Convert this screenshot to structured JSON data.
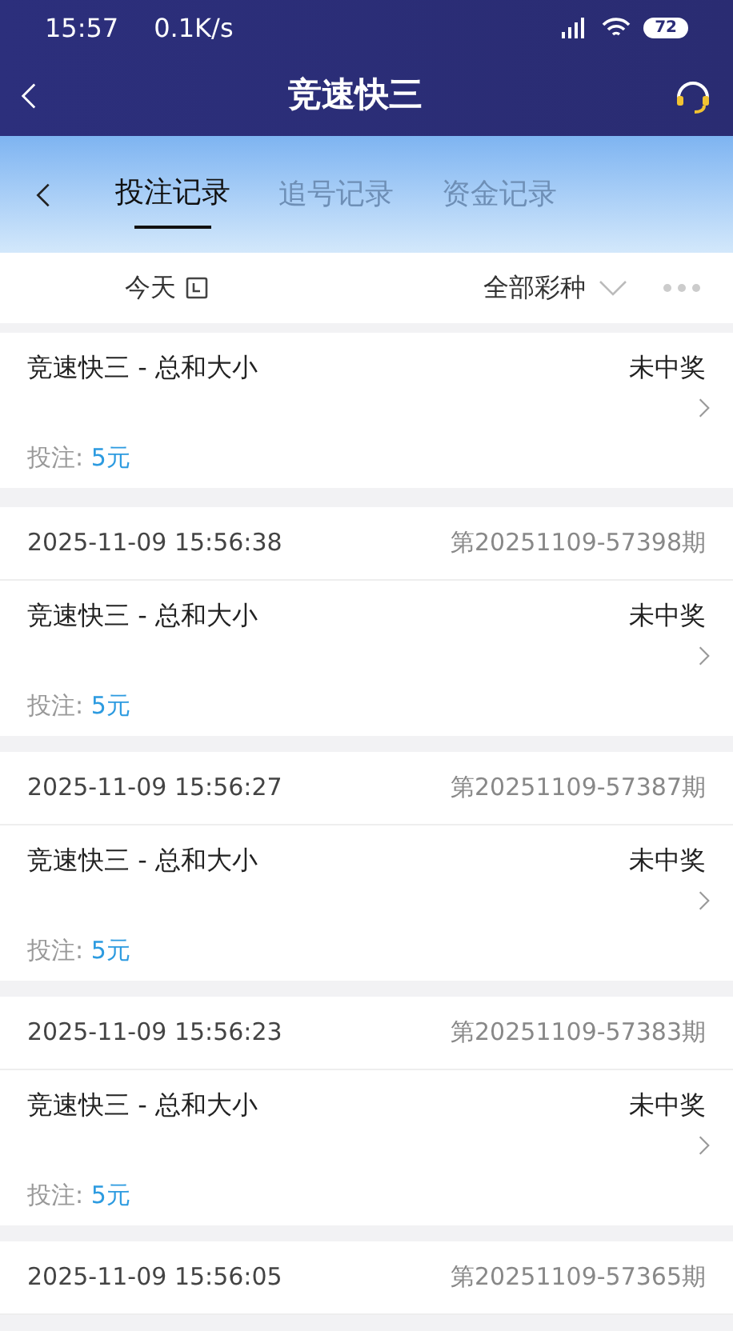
{
  "status_bar": {
    "time": "15:57",
    "speed": "0.1K/s",
    "battery": "72"
  },
  "header": {
    "title": "竞速快三"
  },
  "tabs": [
    {
      "label": "投注记录",
      "selected": true
    },
    {
      "label": "追号记录",
      "selected": false
    },
    {
      "label": "资金记录",
      "selected": false
    }
  ],
  "filters": {
    "date": "今天",
    "lottery": "全部彩种"
  },
  "records": [
    {
      "title": "竞速快三 - 总和大小",
      "result": "未中奖",
      "stake_label": "投注:",
      "stake": "5元"
    },
    {
      "date": "2025-11-09 15:56:38",
      "period": "第20251109-57398期",
      "title": "竞速快三 - 总和大小",
      "result": "未中奖",
      "stake_label": "投注:",
      "stake": "5元"
    },
    {
      "date": "2025-11-09 15:56:27",
      "period": "第20251109-57387期",
      "title": "竞速快三 - 总和大小",
      "result": "未中奖",
      "stake_label": "投注:",
      "stake": "5元"
    },
    {
      "date": "2025-11-09 15:56:23",
      "period": "第20251109-57383期",
      "title": "竞速快三 - 总和大小",
      "result": "未中奖",
      "stake_label": "投注:",
      "stake": "5元"
    },
    {
      "date": "2025-11-09 15:56:05",
      "period": "第20251109-57365期"
    }
  ]
}
